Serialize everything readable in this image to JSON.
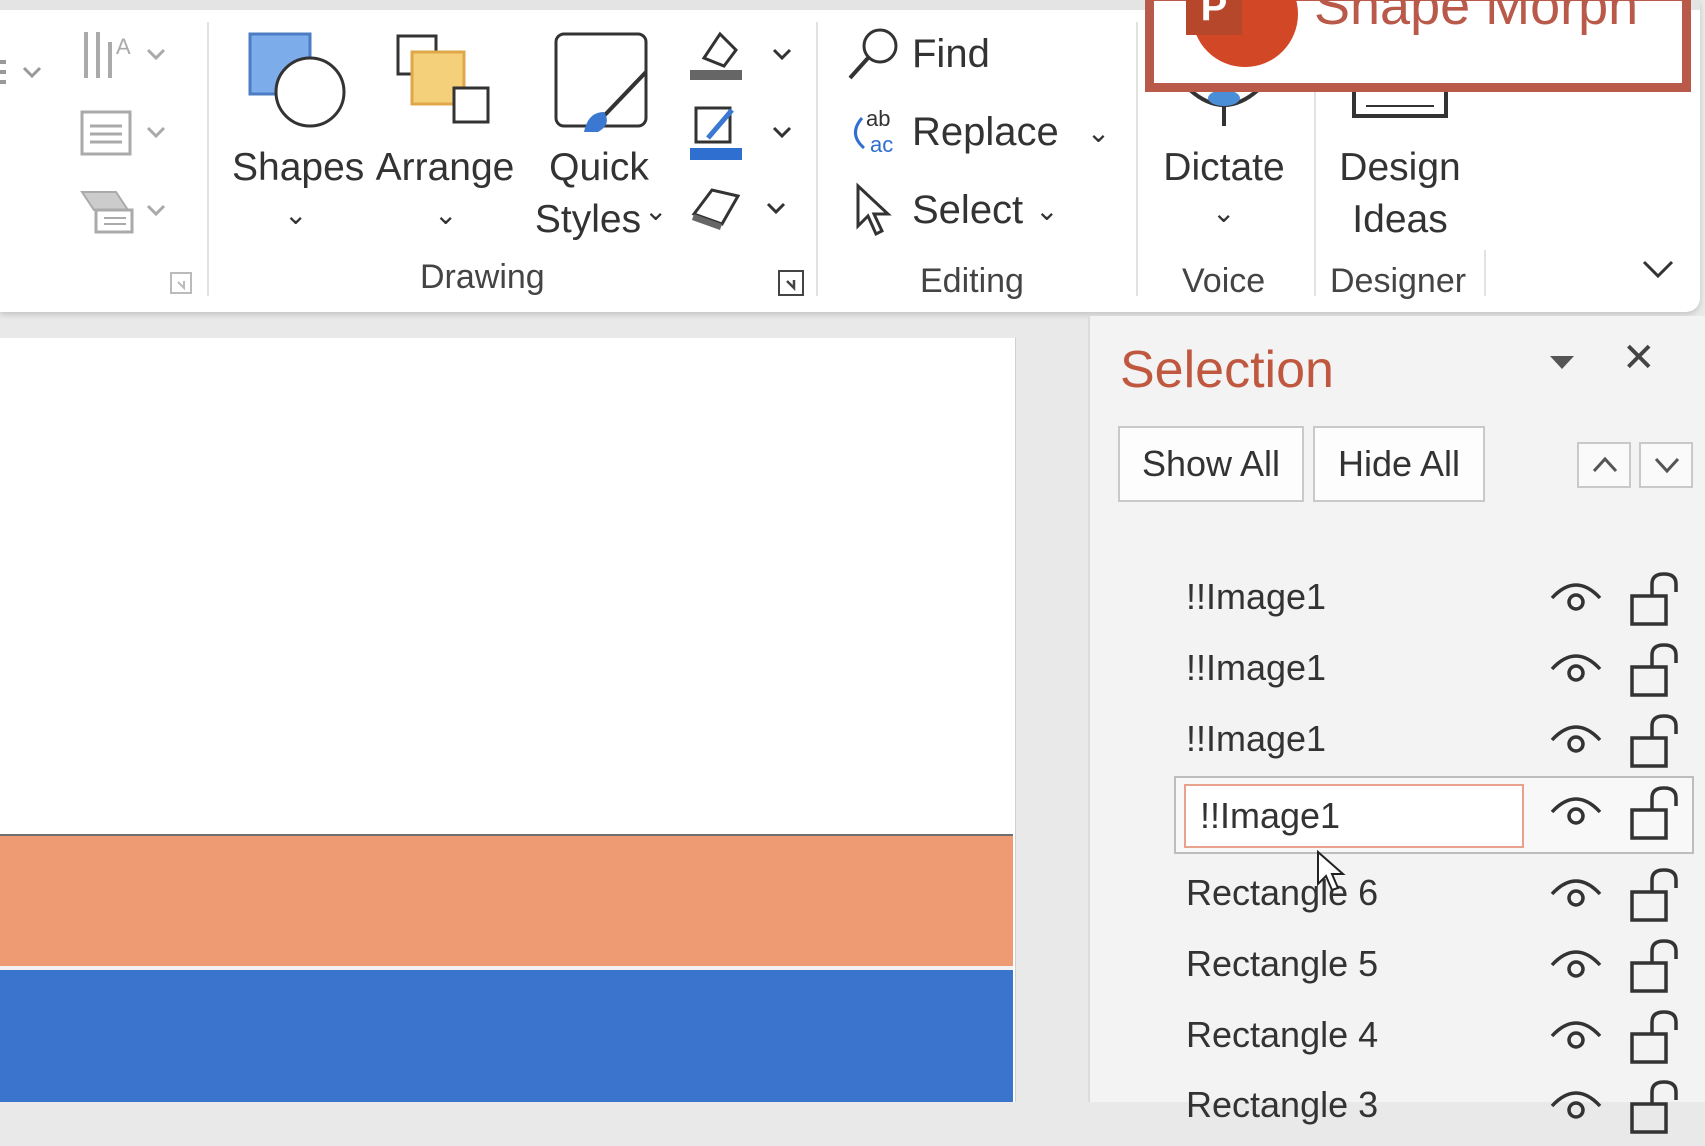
{
  "ribbon": {
    "drawing": {
      "shapes_label": "Shapes",
      "arrange_label": "Arrange",
      "quick_styles_line1": "Quick",
      "quick_styles_line2": "Styles",
      "group_label": "Drawing"
    },
    "editing": {
      "find_label": "Find",
      "replace_label": "Replace",
      "select_label": "Select",
      "group_label": "Editing"
    },
    "voice": {
      "dictate_label": "Dictate",
      "group_label": "Voice"
    },
    "designer": {
      "design_ideas_line1": "Design",
      "design_ideas_line2": "Ideas",
      "group_label": "Designer"
    }
  },
  "badge": {
    "title": "Shape Morph",
    "logo_letter": "P"
  },
  "selection_pane": {
    "title": "Selection",
    "show_all_label": "Show All",
    "hide_all_label": "Hide All",
    "items": [
      {
        "name": "!!Image1"
      },
      {
        "name": "!!Image1"
      },
      {
        "name": "!!Image1"
      },
      {
        "name": "!!Image1",
        "editing": true
      },
      {
        "name": "Rectangle 6"
      },
      {
        "name": "Rectangle 5"
      },
      {
        "name": "Rectangle 4"
      },
      {
        "name": "Rectangle 3"
      }
    ]
  },
  "colors": {
    "accent": "#c0583f",
    "badge_border": "#b8594a",
    "slide_orange": "#ee9a73",
    "slide_blue": "#3b74cc"
  },
  "icons": [
    "text-direction-icon",
    "align-text-icon",
    "smartart-icon",
    "shapes-icon",
    "arrange-icon",
    "quick-styles-icon",
    "shape-fill-icon",
    "shape-outline-icon",
    "shape-effects-icon",
    "find-icon",
    "replace-icon",
    "select-icon",
    "microphone-icon",
    "design-ideas-icon",
    "eye-icon",
    "lock-icon",
    "close-icon",
    "up-arrow-icon",
    "down-arrow-icon",
    "chevron-down-icon"
  ]
}
